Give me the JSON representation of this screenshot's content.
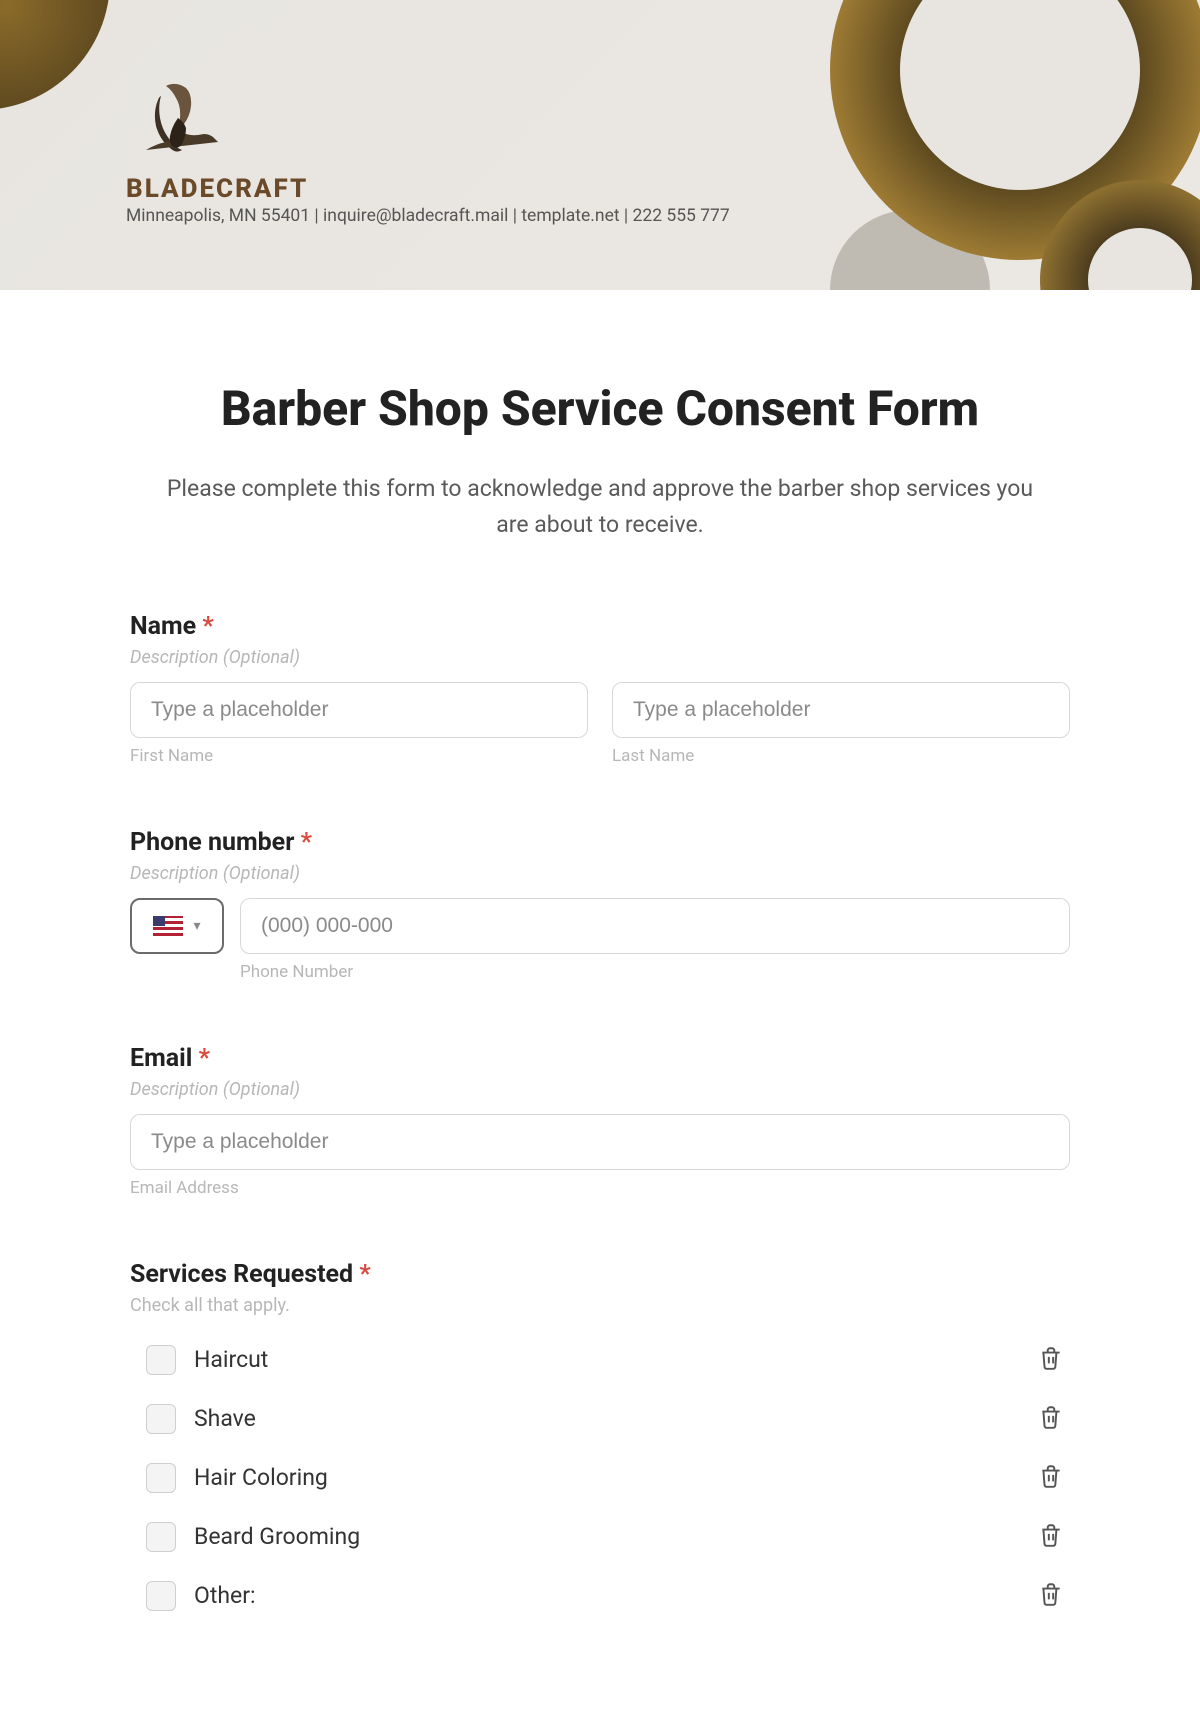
{
  "brand": {
    "name": "BLADECRAFT",
    "contact": "Minneapolis, MN 55401 | inquire@bladecraft.mail | template.net | 222 555 777"
  },
  "form": {
    "title": "Barber Shop Service Consent Form",
    "subtitle": "Please complete this form to acknowledge and approve the barber shop services you are about to receive."
  },
  "name_field": {
    "label": "Name",
    "required": "*",
    "description": "Description (Optional)",
    "first_placeholder": "Type a placeholder",
    "first_sublabel": "First Name",
    "last_placeholder": "Type a placeholder",
    "last_sublabel": "Last Name"
  },
  "phone_field": {
    "label": "Phone number",
    "required": "*",
    "description": "Description (Optional)",
    "placeholder": "(000) 000-000",
    "sublabel": "Phone Number"
  },
  "email_field": {
    "label": "Email",
    "required": "*",
    "description": "Description (Optional)",
    "placeholder": "Type a placeholder",
    "sublabel": "Email Address"
  },
  "services_field": {
    "label": "Services Requested",
    "required": "*",
    "description": "Check all that apply.",
    "options": {
      "o0": "Haircut",
      "o1": "Shave",
      "o2": "Hair Coloring",
      "o3": "Beard Grooming",
      "o4": "Other:"
    }
  }
}
